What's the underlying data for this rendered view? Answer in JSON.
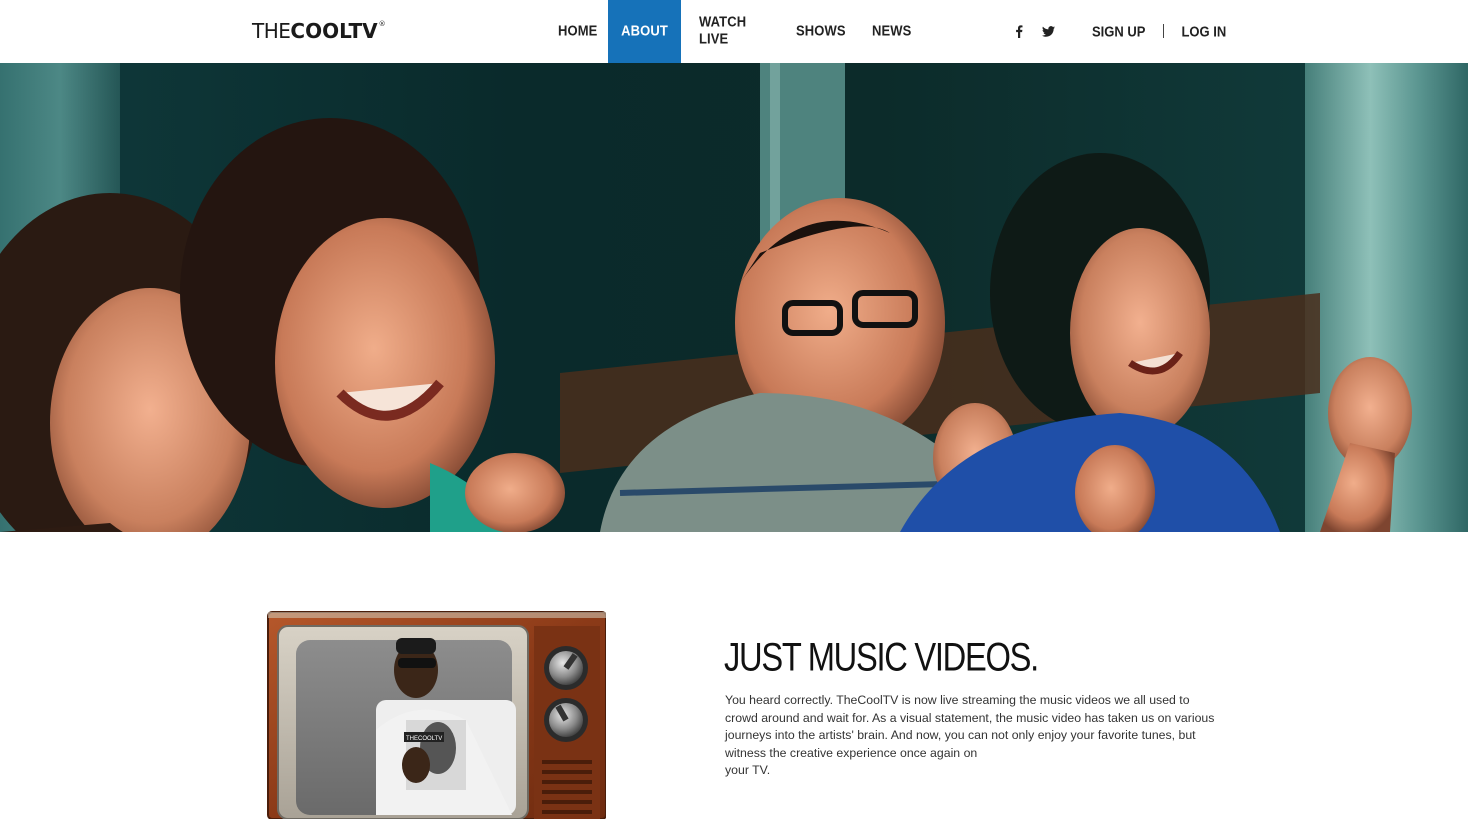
{
  "brand": {
    "logo_part1": "THE",
    "logo_part2": "COOLTV",
    "logo_mark": "®"
  },
  "nav": {
    "items": [
      {
        "label": "HOME"
      },
      {
        "label": "ABOUT"
      },
      {
        "label": "WATCH LIVE"
      },
      {
        "label": "SHOWS"
      },
      {
        "label": "NEWS"
      }
    ],
    "active_index": 1,
    "active_color": "#1672b9"
  },
  "social": {
    "icons": [
      "facebook-icon",
      "twitter-icon"
    ]
  },
  "account": {
    "signup_label": "SIGN UP",
    "login_label": "LOG IN"
  },
  "hero": {
    "image": "photo of four friends excitedly watching, teal-toned"
  },
  "about": {
    "headline": "JUST MUSIC VIDEOS.",
    "paragraph_lines": [
      "You heard correctly. TheCoolTV is now live streaming the music videos we all used to",
      "crowd around and wait for. As a visual statement, the music video has taken us on various",
      "journeys into the artists' brain. And now, you can not only enjoy your favorite tunes, but",
      "witness the creative experience once again on",
      "your TV."
    ],
    "tv_screen_label": "THECOOLTV"
  }
}
